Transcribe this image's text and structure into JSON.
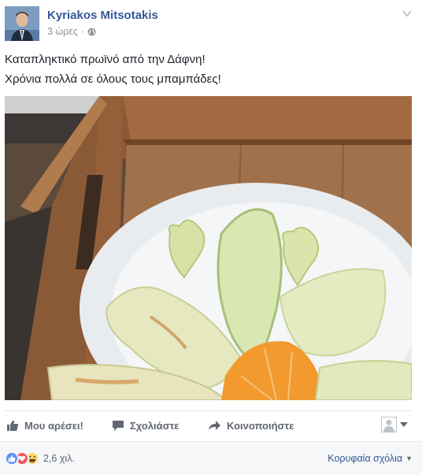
{
  "post": {
    "author": "Kyriakos Mitsotakis",
    "timestamp": "3 ώρες",
    "separator": "·",
    "audience_icon": "globe-icon",
    "text_lines": [
      "Καταπληκτικό πρωϊνό από την Δάφνη!",
      "Χρόνια πολλά σε όλους τους μπαμπάδες!"
    ],
    "photo_icon": "breakfast-plate-photo"
  },
  "actions": {
    "like_label": "Μου αρέσει!",
    "comment_label": "Σχολιάστε",
    "share_label": "Κοινοποιήστε"
  },
  "footer": {
    "reaction_count": "2,6 χιλ.",
    "sort_label": "Κορυφαία σχόλια",
    "reactions": [
      "like-reaction-icon",
      "love-reaction-icon",
      "haha-reaction-icon"
    ]
  },
  "colors": {
    "brand_link": "#365899",
    "like_blue": "#5890ff",
    "love_red": "#f25268",
    "haha_yellow": "#fcd55c",
    "muted": "#90949c"
  }
}
